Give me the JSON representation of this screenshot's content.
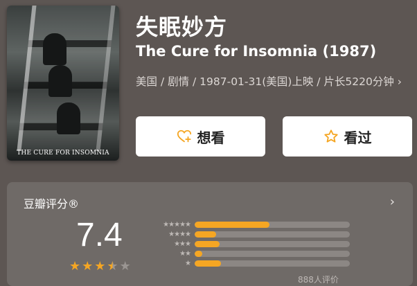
{
  "movie": {
    "title_cn": "失眠妙方",
    "title_en": "The Cure for Insomnia (1987)",
    "meta": "美国 / 剧情 / 1987-01-31(美国)上映 / 片长5220分钟 ›",
    "poster_caption": "THE CURE FOR INSOMNIA"
  },
  "actions": {
    "want_label": "想看",
    "seen_label": "看过"
  },
  "rating": {
    "title": "豆瓣评分®",
    "score": "7.4",
    "stars_value": 3.5,
    "stars_max": 5,
    "distribution": [
      {
        "stars": 5,
        "fraction": 0.48
      },
      {
        "stars": 4,
        "fraction": 0.14
      },
      {
        "stars": 3,
        "fraction": 0.16
      },
      {
        "stars": 2,
        "fraction": 0.05
      },
      {
        "stars": 1,
        "fraction": 0.17
      }
    ],
    "count_text": "888人评价"
  },
  "colors": {
    "accent": "#f5a623",
    "background": "#5d5653",
    "card": "#6f6a67"
  }
}
